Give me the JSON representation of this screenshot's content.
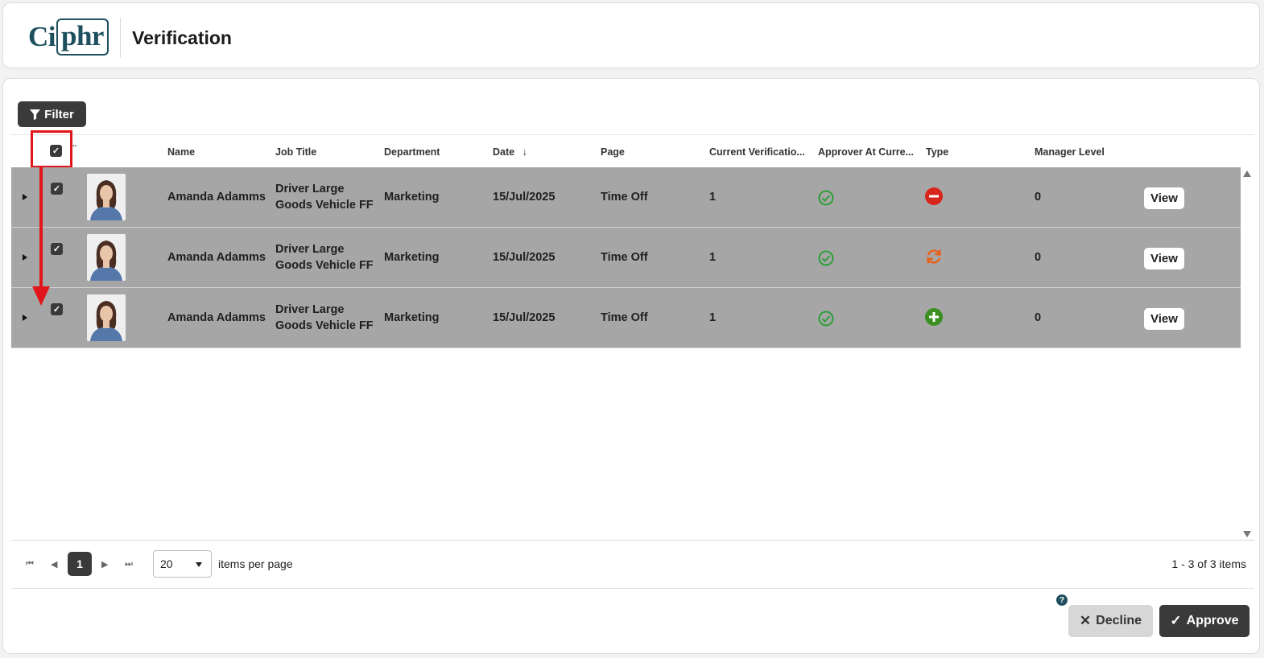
{
  "header": {
    "logo_text": "Ciphr",
    "logo_left": "Ci",
    "logo_right": "phr",
    "title": "Verification"
  },
  "toolbar": {
    "filter_label": "Filter"
  },
  "columns": {
    "ellipsis": "..",
    "name": "Name",
    "job_title": "Job Title",
    "department": "Department",
    "date": "Date",
    "page": "Page",
    "current_verification": "Current Verificatio...",
    "approver": "Approver At Curre...",
    "type": "Type",
    "manager_level": "Manager Level"
  },
  "rows": [
    {
      "name": "Amanda Adamms",
      "job_line1": "Driver Large",
      "job_line2": "Goods Vehicle FF",
      "department": "Marketing",
      "date": "15/Jul/2025",
      "page": "Time Off",
      "current_verification": "1",
      "type_icon": "minus-circle-icon",
      "manager_level": "0",
      "view_label": "View"
    },
    {
      "name": "Amanda Adamms",
      "job_line1": "Driver Large",
      "job_line2": "Goods Vehicle FF",
      "department": "Marketing",
      "date": "15/Jul/2025",
      "page": "Time Off",
      "current_verification": "1",
      "type_icon": "refresh-icon",
      "manager_level": "0",
      "view_label": "View"
    },
    {
      "name": "Amanda Adamms",
      "job_line1": "Driver Large",
      "job_line2": "Goods Vehicle FF",
      "department": "Marketing",
      "date": "15/Jul/2025",
      "page": "Time Off",
      "current_verification": "1",
      "type_icon": "plus-circle-icon",
      "manager_level": "0",
      "view_label": "View"
    }
  ],
  "pager": {
    "current_page": "1",
    "page_size": "20",
    "items_per_page_label": "items per page",
    "info": "1 - 3 of 3 items"
  },
  "actions": {
    "decline_label": "Decline",
    "approve_label": "Approve",
    "help": "?"
  },
  "colors": {
    "accent": "#1d4f5e",
    "row_bg": "#a6a6a6",
    "ok": "#2e9e3b",
    "remove": "#d9261c",
    "change": "#e8601a",
    "add": "#3b8f21",
    "annotation": "#e0161b"
  }
}
